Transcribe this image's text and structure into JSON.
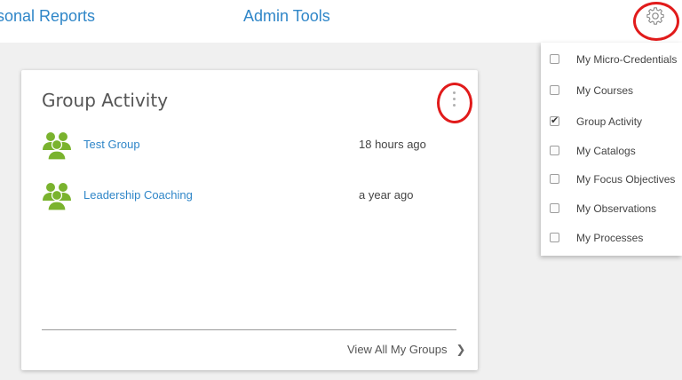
{
  "topnav": {
    "reports_label": "sonal Reports",
    "admin_label": "Admin Tools"
  },
  "colors": {
    "link": "#2f86c8",
    "group_icon": "#7ab32e",
    "highlight": "#e11b1b"
  },
  "card": {
    "title": "Group Activity",
    "groups": [
      {
        "name": "Test Group",
        "time": "18 hours ago",
        "icon": "group-people-icon"
      },
      {
        "name": "Leadership Coaching",
        "time": "a year ago",
        "icon": "group-people-icon"
      }
    ],
    "footer_link": "View All My Groups",
    "footer_chevron": "❯"
  },
  "dropdown": {
    "items": [
      {
        "label": "My Micro-Credentials",
        "checked": false
      },
      {
        "label": "My Courses",
        "checked": false
      },
      {
        "label": "Group Activity",
        "checked": true
      },
      {
        "label": "My Catalogs",
        "checked": false
      },
      {
        "label": "My Focus Objectives",
        "checked": false
      },
      {
        "label": "My Observations",
        "checked": false
      },
      {
        "label": "My Processes",
        "checked": false
      }
    ]
  }
}
